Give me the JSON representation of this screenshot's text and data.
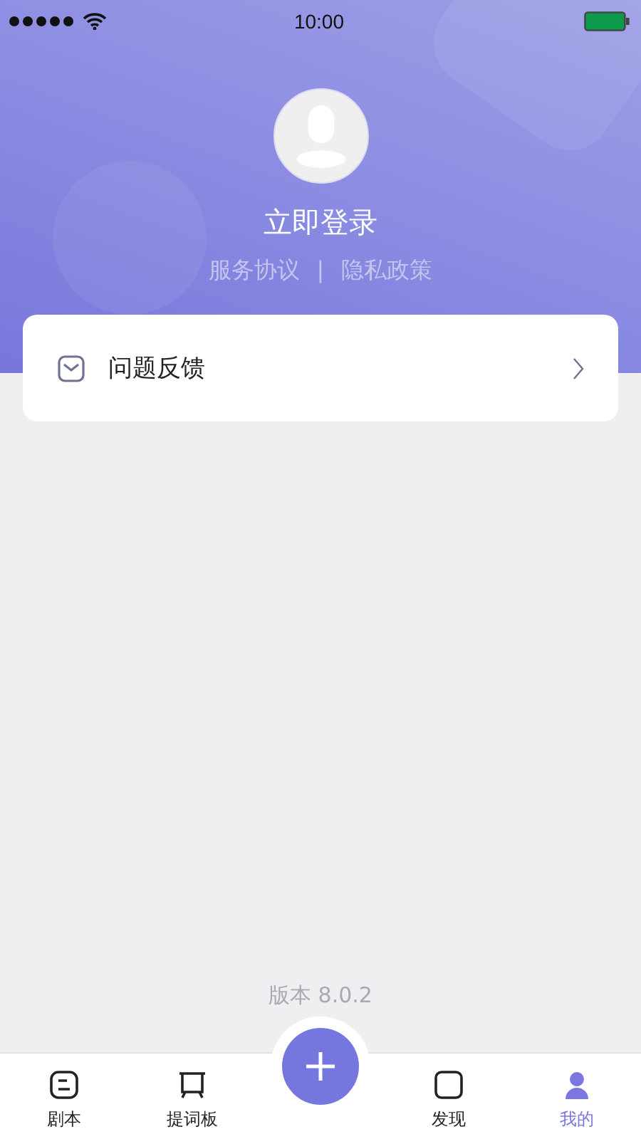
{
  "status_bar": {
    "time": "10:00"
  },
  "profile": {
    "login": "立即登录",
    "links": [
      "服务协议",
      "隐私政策"
    ],
    "separator": "|"
  },
  "menu": [
    {
      "label": "问题反馈"
    }
  ],
  "version": "版本 8.0.2",
  "tab_bar": {
    "tabs": [
      {
        "label": "剧本",
        "selected": false
      },
      {
        "label": "提词板",
        "selected": false
      },
      {
        "label": "发现",
        "selected": false
      },
      {
        "label": "我的",
        "selected": true
      }
    ]
  }
}
